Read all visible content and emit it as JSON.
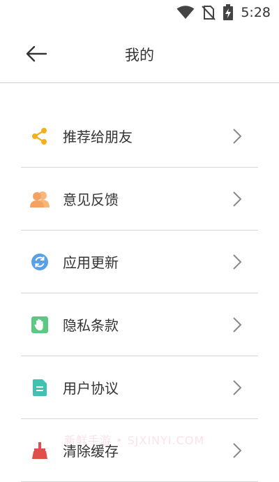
{
  "status_bar": {
    "time": "5:28",
    "icons": [
      "wifi-icon",
      "no-sim-icon",
      "battery-charging-icon"
    ]
  },
  "header": {
    "title": "我的",
    "back_icon": "arrow-left-icon"
  },
  "menu": {
    "items": [
      {
        "label": "推荐给朋友",
        "icon": "share-icon",
        "color": "#F2B01E"
      },
      {
        "label": "意见反馈",
        "icon": "feedback-people-icon",
        "color": "#F4A261"
      },
      {
        "label": "应用更新",
        "icon": "refresh-icon",
        "color": "#5AA0E6"
      },
      {
        "label": "隐私条款",
        "icon": "hand-icon",
        "color": "#5CC982"
      },
      {
        "label": "用户协议",
        "icon": "document-icon",
        "color": "#3FC2B2"
      },
      {
        "label": "清除缓存",
        "icon": "broom-icon",
        "color": "#E0504A"
      }
    ]
  },
  "watermark": "新鲜手游 • SJXINYI.COM"
}
